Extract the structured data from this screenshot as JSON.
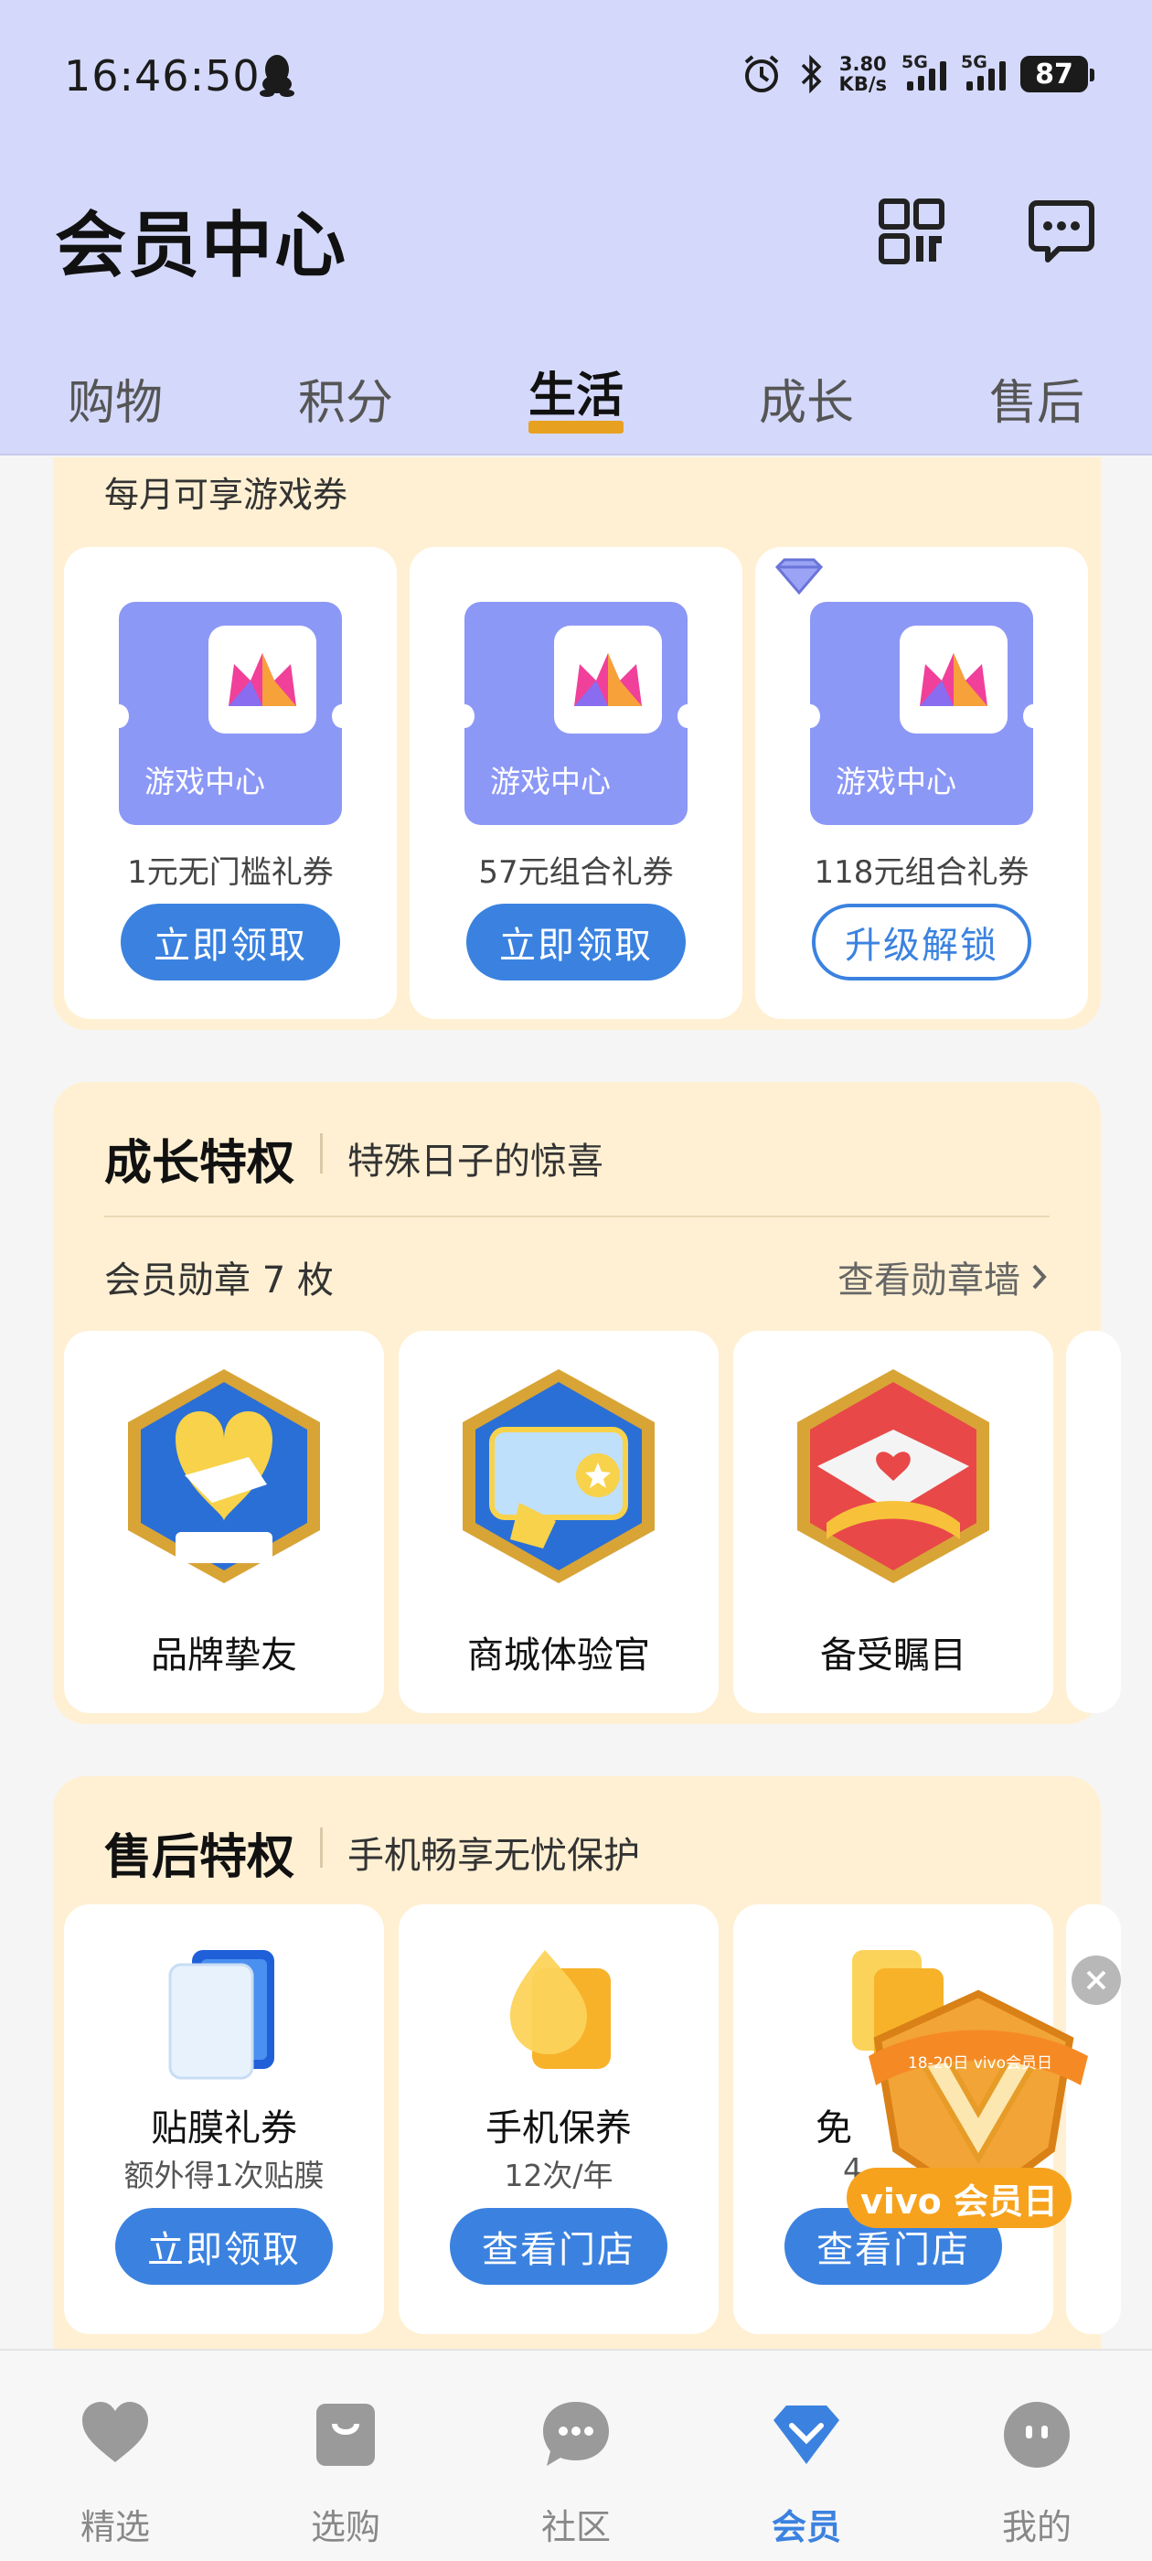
{
  "status_bar": {
    "time": "16:46:50",
    "net_speed_value": "3.80",
    "net_speed_unit": "KB/s",
    "signal1_label": "5G",
    "signal2_label": "5G",
    "battery": "87"
  },
  "header": {
    "title": "会员中心",
    "tabs": [
      {
        "label": "购物"
      },
      {
        "label": "积分"
      },
      {
        "label": "生活"
      },
      {
        "label": "成长"
      },
      {
        "label": "售后"
      }
    ],
    "active_tab": "生活"
  },
  "game_section": {
    "caption": "每月可享游戏券",
    "cards": [
      {
        "coupon_text": "游戏中心",
        "label": "1元无门槛礼券",
        "button": "立即领取"
      },
      {
        "coupon_text": "游戏中心",
        "label": "57元组合礼券",
        "button": "立即领取"
      },
      {
        "coupon_text": "游戏中心",
        "label": "118元组合礼券",
        "button": "升级解锁"
      }
    ]
  },
  "growth_section": {
    "title": "成长特权",
    "subtitle": "特殊日子的惊喜",
    "badge_count": "会员勋章 7 枚",
    "see_wall": "查看勋章墙",
    "badges": [
      {
        "name": "品牌挚友",
        "icon": "handshake-badge-icon"
      },
      {
        "name": "商城体验官",
        "icon": "experience-officer-badge-icon"
      },
      {
        "name": "备受瞩目",
        "icon": "heart-spotlight-badge-icon"
      }
    ]
  },
  "after_sales_section": {
    "title": "售后特权",
    "subtitle": "手机畅享无忧保护",
    "services": [
      {
        "title": "贴膜礼券",
        "sub": "额外得1次贴膜",
        "button": "立即领取"
      },
      {
        "title": "手机保养",
        "sub": "12次/年",
        "button": "查看门店"
      },
      {
        "title": "免",
        "sub": "4",
        "button": "查看门店"
      }
    ]
  },
  "promo": {
    "label": "vivo 会员日",
    "ribbon": "18-20日 vivo会员日"
  },
  "bottom_nav": {
    "items": [
      {
        "label": "精选"
      },
      {
        "label": "选购"
      },
      {
        "label": "社区"
      },
      {
        "label": "会员"
      },
      {
        "label": "我的"
      }
    ],
    "active": "会员"
  },
  "colors": {
    "header_bg": "#d4d9fb",
    "accent_blue": "#3b82e0",
    "tab_underline": "#e8a020",
    "panel_bg": "#fff0d3",
    "coupon_bg": "#8c98f6"
  }
}
